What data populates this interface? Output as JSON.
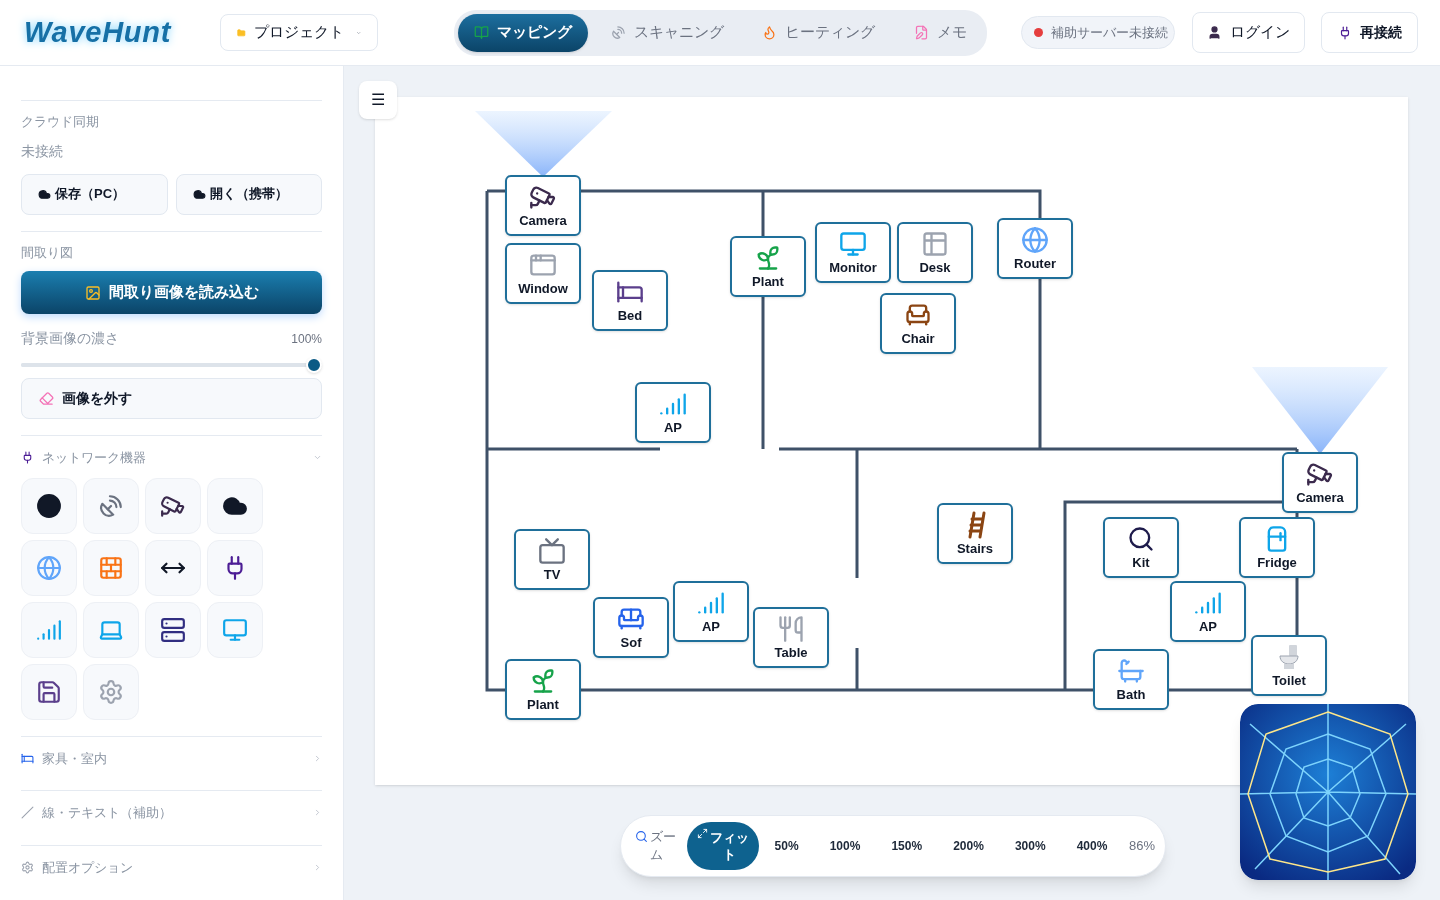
{
  "header": {
    "logo": "WaveHunt",
    "project_menu": {
      "label": "プロジェクト"
    },
    "tabs": [
      {
        "label": "マッピング",
        "selected": true
      },
      {
        "label": "スキャニング",
        "selected": false
      },
      {
        "label": "ヒーティング",
        "selected": false
      },
      {
        "label": "メモ",
        "selected": false
      }
    ],
    "server_status": {
      "label": "補助サーバー未接続",
      "connected": false
    },
    "login_button": "ログイン",
    "reconnect_button": "再接続"
  },
  "sidebar": {
    "cloud_sync": {
      "title": "クラウド同期",
      "status": "未接続",
      "buttons": [
        "保存（PC）",
        "開く（携帯）"
      ]
    },
    "floorplan": {
      "title": "間取り図",
      "load_button": "間取り画像を読み込む",
      "opacity": {
        "label": "背景画像の濃さ",
        "reading": "100%",
        "level": 1
      },
      "remove_button": "画像を外す"
    },
    "sections": [
      {
        "title": "ネットワーク機器",
        "expanded": true
      },
      {
        "title": "家具・室内",
        "expanded": false
      },
      {
        "title": "線・テキスト（補助）",
        "expanded": false
      },
      {
        "title": "配置オプション",
        "expanded": false
      }
    ]
  },
  "canvas": {
    "menu_button": "☰",
    "items": [
      {
        "label": "Camera"
      },
      {
        "label": "Window"
      },
      {
        "label": "Bed"
      },
      {
        "label": "Plant"
      },
      {
        "label": "Monitor"
      },
      {
        "label": "Desk"
      },
      {
        "label": "Chair"
      },
      {
        "label": "Router"
      },
      {
        "label": "AP"
      },
      {
        "label": "TV"
      },
      {
        "label": "Sof"
      },
      {
        "label": "AP"
      },
      {
        "label": "Table"
      },
      {
        "label": "Plant"
      },
      {
        "label": "Stairs"
      },
      {
        "label": "Camera"
      },
      {
        "label": "Kit"
      },
      {
        "label": "Fridge"
      },
      {
        "label": "AP"
      },
      {
        "label": "Bath"
      },
      {
        "label": "Toilet"
      }
    ]
  },
  "zoom_bar": {
    "label": "ズーム",
    "fit_button": "フィット",
    "presets": [
      {
        "label": "50%",
        "selected": false
      },
      {
        "label": "100%",
        "selected": false
      },
      {
        "label": "150%",
        "selected": false
      },
      {
        "label": "200%",
        "selected": false
      },
      {
        "label": "300%",
        "selected": false
      },
      {
        "label": "400%",
        "selected": false
      }
    ],
    "reading": "86%"
  }
}
